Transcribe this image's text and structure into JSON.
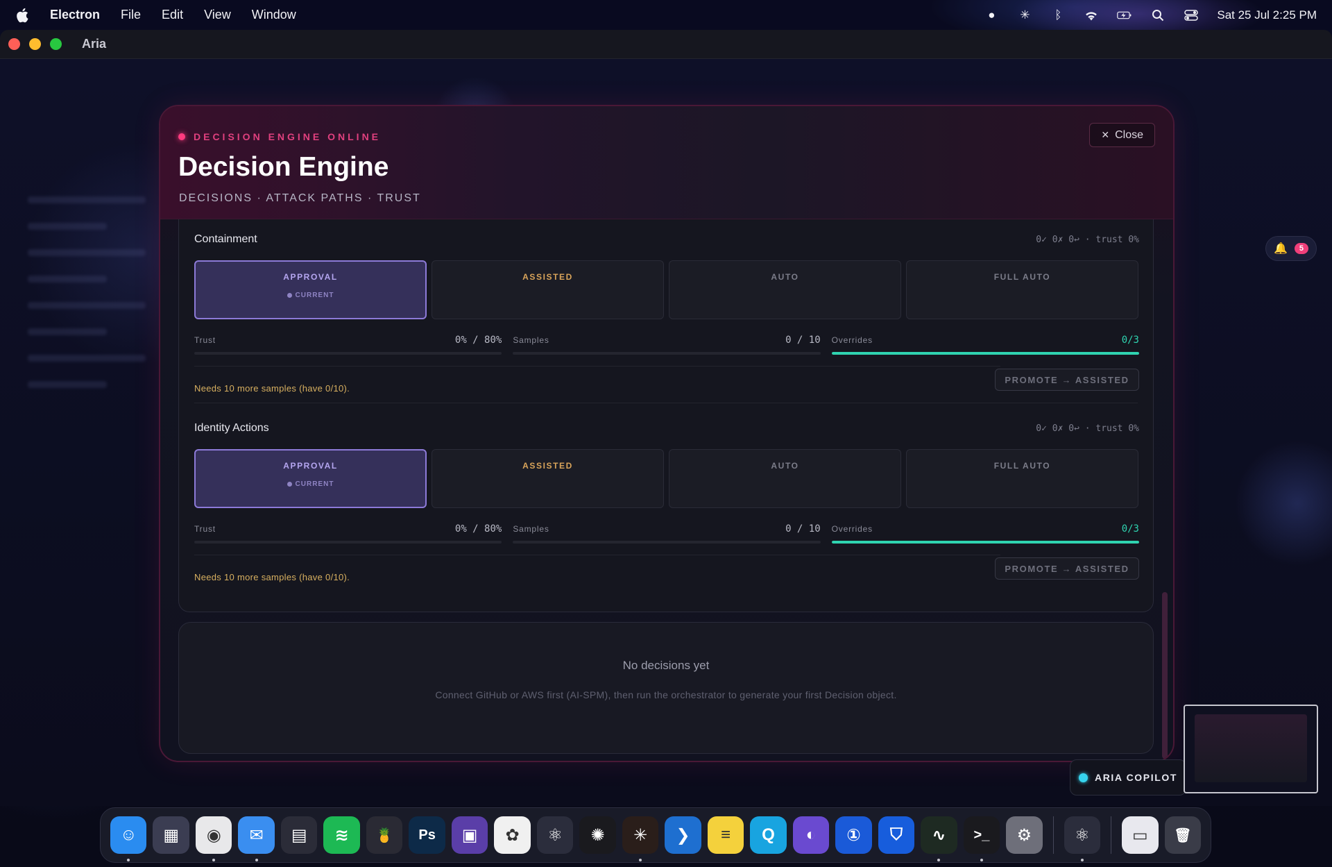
{
  "menubar": {
    "app_name": "Electron",
    "items": [
      "File",
      "Edit",
      "View",
      "Window"
    ],
    "clock": "Sat 25 Jul  2:25 PM",
    "status_icons": [
      "record-icon",
      "snowflake-icon",
      "bluetooth-icon",
      "wifi-icon",
      "battery-charging-icon",
      "spotlight-icon",
      "control-center-icon"
    ]
  },
  "window": {
    "title": "Aria"
  },
  "notifications": {
    "badge": "5"
  },
  "modal": {
    "status_text": "DECISION ENGINE ONLINE",
    "title": "Decision Engine",
    "subtitle": "DECISIONS · ATTACK PATHS · TRUST",
    "close_label": "Close",
    "policies": [
      {
        "name": "Containment",
        "meta": "0✓ 0✗ 0↩ · trust 0%",
        "levels": [
          "APPROVAL",
          "ASSISTED",
          "AUTO",
          "FULL AUTO"
        ],
        "current_tag": "CURRENT",
        "trust_label": "Trust",
        "trust_value": "0% / 80%",
        "trust_fill": 0,
        "samples_label": "Samples",
        "samples_value": "0 / 10",
        "samples_fill": 0,
        "overrides_label": "Overrides",
        "overrides_value": "0/3",
        "overrides_fill": 1,
        "needs": "Needs 10 more samples (have 0/10).",
        "promote_label": "PROMOTE → ASSISTED"
      },
      {
        "name": "Identity Actions",
        "meta": "0✓ 0✗ 0↩ · trust 0%",
        "levels": [
          "APPROVAL",
          "ASSISTED",
          "AUTO",
          "FULL AUTO"
        ],
        "current_tag": "CURRENT",
        "trust_label": "Trust",
        "trust_value": "0% / 80%",
        "trust_fill": 0,
        "samples_label": "Samples",
        "samples_value": "0 / 10",
        "samples_fill": 0,
        "overrides_label": "Overrides",
        "overrides_value": "0/3",
        "overrides_fill": 1,
        "needs": "Needs 10 more samples (have 0/10).",
        "promote_label": "PROMOTE → ASSISTED"
      }
    ],
    "empty": {
      "title": "No decisions yet",
      "description": "Connect GitHub or AWS first (AI-SPM), then run the orchestrator to generate your first Decision object."
    }
  },
  "copilot": {
    "label": "ARIA COPILOT"
  },
  "dock": {
    "apps": [
      {
        "name": "finder-icon",
        "color": "#2a8cf0",
        "glyph": "☺",
        "running": true
      },
      {
        "name": "launchpad-icon",
        "color": "#3b3d52",
        "glyph": "▦",
        "running": false
      },
      {
        "name": "chrome-icon",
        "color": "#e8e8ea",
        "glyph": "◉",
        "running": true
      },
      {
        "name": "mail-icon",
        "color": "#3a8ef0",
        "glyph": "✉",
        "running": true
      },
      {
        "name": "calendar-grid-icon",
        "color": "#2b2c38",
        "glyph": "▤",
        "running": false
      },
      {
        "name": "spotify-icon",
        "color": "#1db954",
        "glyph": "≋",
        "running": false
      },
      {
        "name": "cocktail-icon",
        "color": "#2a2a34",
        "glyph": "🍍",
        "running": false
      },
      {
        "name": "photoshop-icon",
        "color": "#0d2a48",
        "glyph": "Ps",
        "running": false
      },
      {
        "name": "clapper-icon",
        "color": "#5a3ea8",
        "glyph": "▣",
        "running": false
      },
      {
        "name": "photos-icon",
        "color": "#f0f0f0",
        "glyph": "✿",
        "running": false
      },
      {
        "name": "electron-icon",
        "color": "#2b2d3c",
        "glyph": "⚛",
        "running": false
      },
      {
        "name": "chatgpt-icon",
        "color": "#1a1a1e",
        "glyph": "✺",
        "running": false
      },
      {
        "name": "claude-icon",
        "color": "#2a1e1a",
        "glyph": "✳",
        "running": true
      },
      {
        "name": "vscode-icon",
        "color": "#1e6fd0",
        "glyph": "❯",
        "running": false
      },
      {
        "name": "notes-icon",
        "color": "#f4d13c",
        "glyph": "≡",
        "running": false
      },
      {
        "name": "quicktime-icon",
        "color": "#18a4e0",
        "glyph": "Q",
        "running": false
      },
      {
        "name": "tor-icon",
        "color": "#6a4ad0",
        "glyph": "◐",
        "running": false
      },
      {
        "name": "onepassword-icon",
        "color": "#1a5ad8",
        "glyph": "①",
        "running": false
      },
      {
        "name": "bitwarden-icon",
        "color": "#175ddc",
        "glyph": "⛉",
        "running": false
      },
      {
        "name": "activity-monitor-icon",
        "color": "#1e2a22",
        "glyph": "∿",
        "running": true
      },
      {
        "name": "terminal-icon",
        "color": "#1a1a1e",
        "glyph": ">_",
        "running": true
      },
      {
        "name": "settings-icon",
        "color": "#6e6f7a",
        "glyph": "⚙",
        "running": false
      }
    ],
    "pinned": [
      {
        "name": "electron-icon",
        "color": "#2b2d3c",
        "glyph": "⚛",
        "running": true
      }
    ],
    "trailing": [
      {
        "name": "document-icon",
        "color": "#e8e8ee",
        "glyph": "▭",
        "running": false
      },
      {
        "name": "trash-icon",
        "color": "#3a3c48",
        "glyph": "🗑",
        "running": false
      }
    ]
  }
}
